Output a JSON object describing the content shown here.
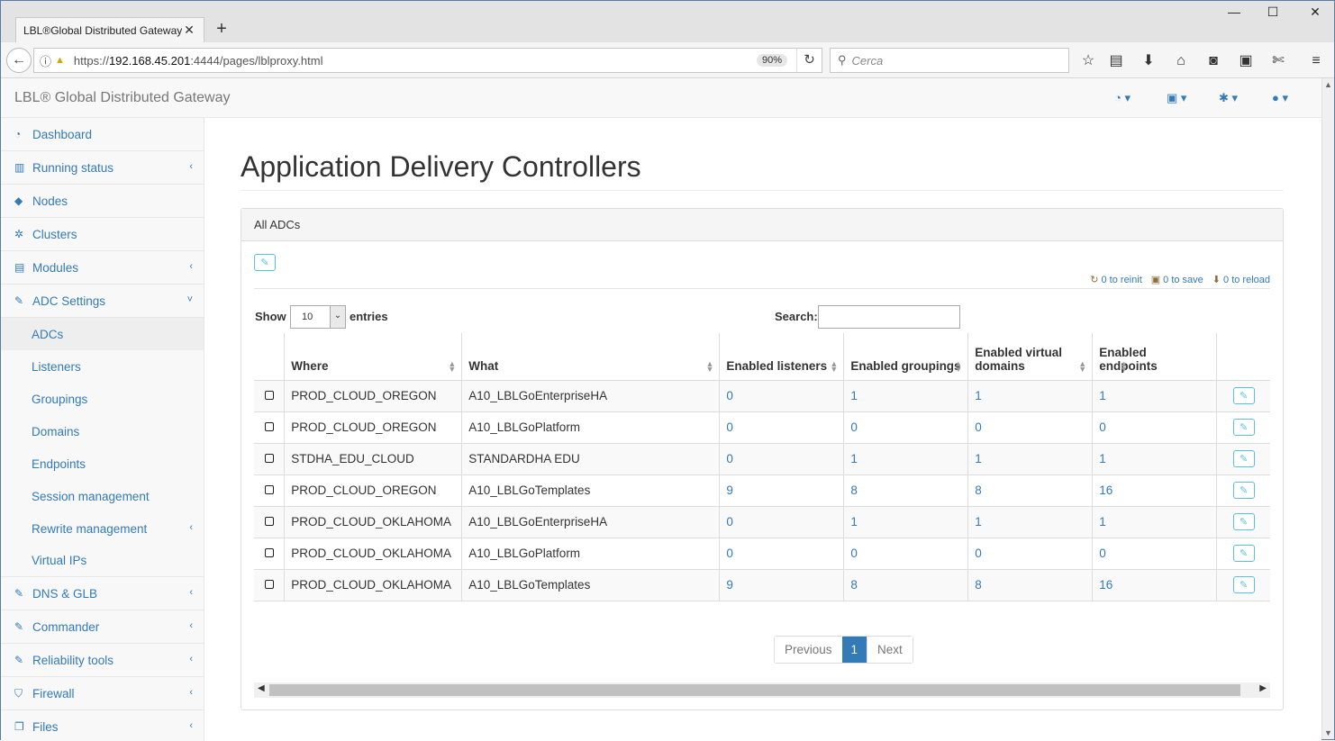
{
  "browser": {
    "tab_title": "LBL®Global Distributed Gateway",
    "url_prefix": "https://",
    "url_host": "192.168.45.201",
    "url_rest": ":4444/pages/lblproxy.html",
    "zoom": "90%",
    "search_placeholder": "Cerca",
    "win_min": "—",
    "win_max": "☐",
    "win_close": "✕"
  },
  "app": {
    "brand": "LBL® Global Distributed Gateway",
    "header_icons": [
      "dashboard-icon",
      "save-icon",
      "gear-icon",
      "user-icon"
    ]
  },
  "sidebar": {
    "items": [
      {
        "label": "Dashboard",
        "icon": "dashboard-icon",
        "chevron": ""
      },
      {
        "label": "Running status",
        "icon": "bar-chart-icon",
        "chevron": "‹"
      },
      {
        "label": "Nodes",
        "icon": "cube-icon",
        "chevron": ""
      },
      {
        "label": "Clusters",
        "icon": "cogs-icon",
        "chevron": ""
      },
      {
        "label": "Modules",
        "icon": "list-icon",
        "chevron": "‹"
      },
      {
        "label": "ADC Settings",
        "icon": "edit-icon",
        "chevron": "˅"
      }
    ],
    "subitems": [
      {
        "label": "ADCs",
        "chevron": ""
      },
      {
        "label": "Listeners",
        "chevron": ""
      },
      {
        "label": "Groupings",
        "chevron": ""
      },
      {
        "label": "Domains",
        "chevron": ""
      },
      {
        "label": "Endpoints",
        "chevron": ""
      },
      {
        "label": "Session management",
        "chevron": ""
      },
      {
        "label": "Rewrite management",
        "chevron": "‹"
      },
      {
        "label": "Virtual IPs",
        "chevron": ""
      }
    ],
    "items2": [
      {
        "label": "DNS & GLB",
        "icon": "edit-icon",
        "chevron": "‹"
      },
      {
        "label": "Commander",
        "icon": "edit-icon",
        "chevron": "‹"
      },
      {
        "label": "Reliability tools",
        "icon": "edit-icon",
        "chevron": "‹"
      },
      {
        "label": "Firewall",
        "icon": "shield-icon",
        "chevron": "‹"
      },
      {
        "label": "Files",
        "icon": "files-icon",
        "chevron": "‹"
      }
    ]
  },
  "main": {
    "title": "Application Delivery Controllers",
    "panel_title": "All ADCs",
    "actions": {
      "reinit": "0 to reinit",
      "save": "0 to save",
      "reload": "0 to reload"
    },
    "show_label": "Show",
    "entries_value": "10",
    "entries_label": "entries",
    "search_label": "Search:",
    "columns": [
      "Where",
      "What",
      "Enabled listeners",
      "Enabled groupings",
      "Enabled virtual domains",
      "Enabled endpoints"
    ],
    "rows": [
      [
        "PROD_CLOUD_OREGON",
        "A10_LBLGoEnterpriseHA",
        "0",
        "1",
        "1",
        "1"
      ],
      [
        "PROD_CLOUD_OREGON",
        "A10_LBLGoPlatform",
        "0",
        "0",
        "0",
        "0"
      ],
      [
        "STDHA_EDU_CLOUD",
        "STANDARDHA EDU",
        "0",
        "1",
        "1",
        "1"
      ],
      [
        "PROD_CLOUD_OREGON",
        "A10_LBLGoTemplates",
        "9",
        "8",
        "8",
        "16"
      ],
      [
        "PROD_CLOUD_OKLAHOMA",
        "A10_LBLGoEnterpriseHA",
        "0",
        "1",
        "1",
        "1"
      ],
      [
        "PROD_CLOUD_OKLAHOMA",
        "A10_LBLGoPlatform",
        "0",
        "0",
        "0",
        "0"
      ],
      [
        "PROD_CLOUD_OKLAHOMA",
        "A10_LBLGoTemplates",
        "9",
        "8",
        "8",
        "16"
      ]
    ],
    "pager": {
      "prev": "Previous",
      "page": "1",
      "next": "Next"
    }
  }
}
